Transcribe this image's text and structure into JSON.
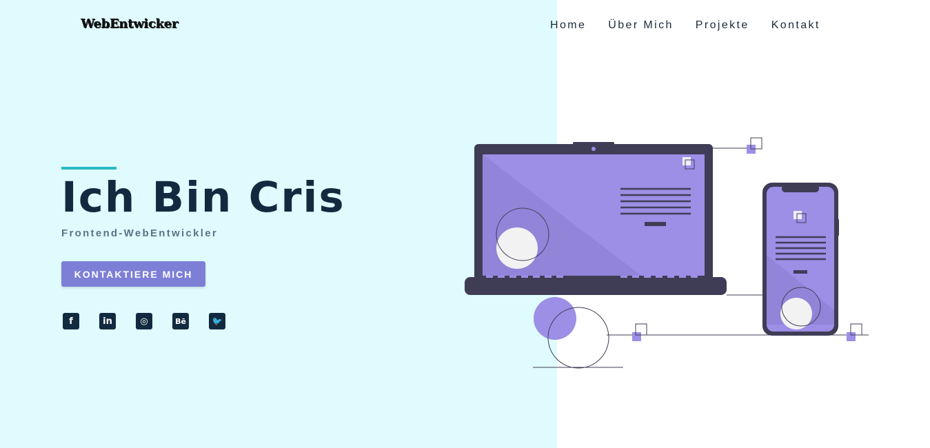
{
  "brand": {
    "logo_text": "WebEntwicker"
  },
  "nav": {
    "items": [
      {
        "label": "Home"
      },
      {
        "label": "Über Mich"
      },
      {
        "label": "Projekte"
      },
      {
        "label": "Kontakt"
      }
    ]
  },
  "hero": {
    "title": "Ich Bin Cris",
    "subtitle": "Frontend-WebEntwickler",
    "cta_label": "KONTAKTIERE MICH"
  },
  "socials": [
    {
      "icon": "facebook-icon",
      "glyph": "f"
    },
    {
      "icon": "linkedin-icon",
      "glyph": "in"
    },
    {
      "icon": "dribbble-icon",
      "glyph": "◎"
    },
    {
      "icon": "behance-icon",
      "glyph": "Bē"
    },
    {
      "icon": "twitter-icon",
      "glyph": "🐦"
    }
  ],
  "colors": {
    "left_background": "#dffbfe",
    "accent": "#29b8c6",
    "button": "#7d7fd7",
    "heading": "#122a3f",
    "device_dark": "#3f3d56",
    "device_screen": "#9d8ee6"
  }
}
